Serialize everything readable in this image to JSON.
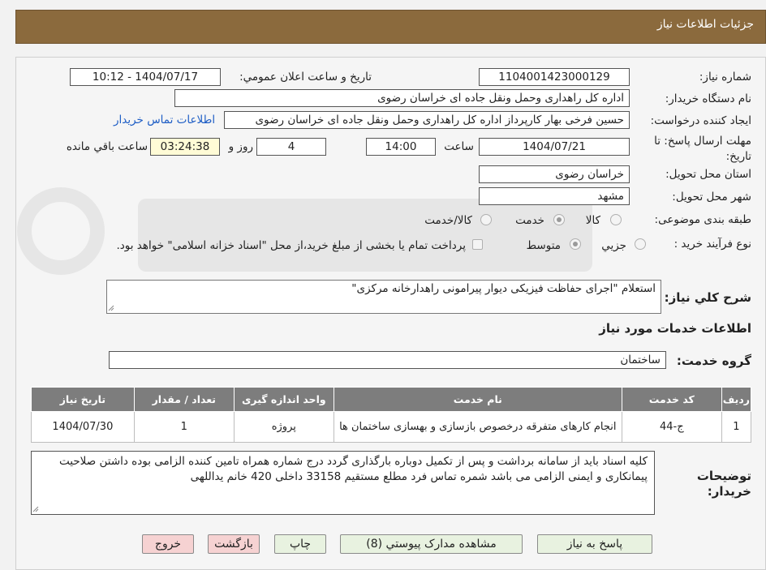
{
  "header": {
    "title": "جزئيات اطلاعات نياز"
  },
  "form": {
    "need_number": {
      "label": "شماره نياز:",
      "value": "1104001423000129"
    },
    "announce_datetime": {
      "label": "تاريخ و ساعت اعلان عمومي:",
      "value": "1404/07/17 - 10:12"
    },
    "buyer_org": {
      "label": "نام دستگاه خريدار:",
      "value": "اداره کل راهداری وحمل ونقل جاده ای خراسان رضوی"
    },
    "requester": {
      "label": "ايجاد کننده درخواست:",
      "value": "حسین فرخی بهار کارپرداز اداره کل راهداری وحمل ونقل جاده ای خراسان رضوی"
    },
    "buyer_contact_link": "اطلاعات تماس خريدار",
    "deadline": {
      "label": "مهلت ارسال پاسخ: تا تاريخ:",
      "date": "1404/07/21",
      "time_label": "ساعت",
      "time": "14:00",
      "days": "4",
      "days_label": "روز و",
      "remaining": "03:24:38",
      "remaining_label": "ساعت باقي مانده"
    },
    "delivery_province": {
      "label": "استان محل تحويل:",
      "value": "خراسان رضوی"
    },
    "delivery_city": {
      "label": "شهر محل تحويل:",
      "value": "مشهد"
    },
    "category": {
      "label": "طبقه بندی موضوعی:",
      "options": [
        "کالا",
        "خدمت",
        "کالا/خدمت"
      ],
      "selected": "خدمت"
    },
    "purchase_type": {
      "label": "نوع فرآيند خريد :",
      "options": [
        "جزيي",
        "متوسط"
      ],
      "selected": "متوسط",
      "note": "پرداخت تمام يا بخشی از مبلغ خريد،از محل \"اسناد خزانه اسلامی\" خواهد بود."
    },
    "description": {
      "label": "شرح کلي نياز:",
      "value": "استعلام \"اجرای حفاظت فیزیکی دیوار پیرامونی راهدارخانه مرکزی\""
    }
  },
  "services": {
    "section_title": "اطلاعات خدمات مورد نياز",
    "group_label": "گروه خدمت:",
    "group_value": "ساختمان",
    "columns": [
      "رديف",
      "کد خدمت",
      "نام خدمت",
      "واحد اندازه گيری",
      "تعداد / مقدار",
      "تاريخ نياز"
    ],
    "rows": [
      [
        "1",
        "ج-44",
        "انجام کارهای متفرقه درخصوص بازسازی و بهسازی ساختمان ها",
        "پروژه",
        "1",
        "1404/07/30"
      ]
    ]
  },
  "buyer_notes": {
    "label": "توضيحات خريدار:",
    "value": "کلیه اسناد باید از سامانه برداشت و پس از تکمیل دوباره بارگذاری گردد درج شماره همراه تامین کننده الزامی بوده داشتن صلاحیت پیمانکاری و ایمنی الزامی می باشد  شمره تماس فرد مطلع مستقیم 33158 داخلی  420 خانم یداللهی"
  },
  "buttons": {
    "reply": "پاسخ به نياز",
    "attachments": "مشاهده مدارک پيوستي (8)",
    "print": "چاپ",
    "back": "بازگشت",
    "exit": "خروج"
  },
  "colors": {
    "header_bg": "#8b6a3d",
    "table_header_bg": "#7d7d7d",
    "button_green": "#e8f2e0",
    "button_pink": "#f6d2d2",
    "link": "#1d5dc5"
  }
}
